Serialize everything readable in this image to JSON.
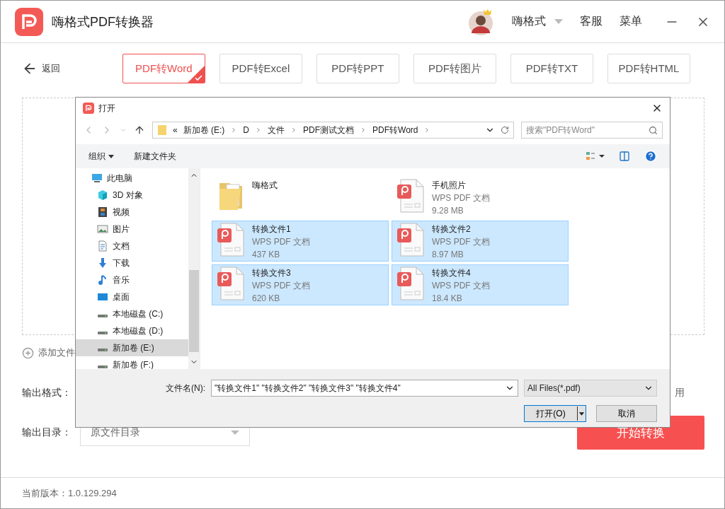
{
  "app": {
    "title": "嗨格式PDF转换器",
    "user": "嗨格式",
    "links": [
      "客服",
      "菜单"
    ],
    "back": "返回",
    "formats": [
      {
        "label": "PDF转Word",
        "selected": true
      },
      {
        "label": "PDF转Excel",
        "selected": false
      },
      {
        "label": "PDF转PPT",
        "selected": false
      },
      {
        "label": "PDF转图片",
        "selected": false
      },
      {
        "label": "PDF转TXT",
        "selected": false
      },
      {
        "label": "PDF转HTML",
        "selected": false
      }
    ],
    "add_file": "添加文件",
    "output_format_label": "输出格式：",
    "partial_text": "用",
    "output_dir": {
      "label": "输出目录：",
      "value": "原文件目录"
    },
    "start_button": "开始转换",
    "version": "当前版本：1.0.129.294"
  },
  "dialog": {
    "title": "打开",
    "path": [
      "«",
      "新加卷 (E:)",
      "D",
      "文件",
      "PDF测试文档",
      "PDF转Word"
    ],
    "search": {
      "placeholder": "搜索\"PDF转Word\""
    },
    "toolbar": [
      "组织",
      "新建文件夹"
    ],
    "nav": [
      {
        "label": "此电脑",
        "kind": "pc",
        "selected": false
      },
      {
        "label": "3D 对象",
        "kind": "cube",
        "selected": false
      },
      {
        "label": "视频",
        "kind": "video",
        "selected": false
      },
      {
        "label": "图片",
        "kind": "image",
        "selected": false
      },
      {
        "label": "文档",
        "kind": "doc",
        "selected": false
      },
      {
        "label": "下载",
        "kind": "download",
        "selected": false
      },
      {
        "label": "音乐",
        "kind": "music",
        "selected": false
      },
      {
        "label": "桌面",
        "kind": "desktop",
        "selected": false
      },
      {
        "label": "本地磁盘 (C:)",
        "kind": "drive",
        "selected": false
      },
      {
        "label": "本地磁盘 (D:)",
        "kind": "drive",
        "selected": false
      },
      {
        "label": "新加卷 (E:)",
        "kind": "drive",
        "selected": true
      },
      {
        "label": "新加卷 (F:)",
        "kind": "drive",
        "selected": false
      }
    ],
    "files": [
      {
        "name": "嗨格式",
        "kind": "folder",
        "selected": false
      },
      {
        "name": "手机照片",
        "type": "WPS PDF 文档",
        "size": "9.28 MB",
        "kind": "pdf",
        "selected": false
      },
      {
        "name": "转换文件1",
        "type": "WPS PDF 文档",
        "size": "437 KB",
        "kind": "pdf",
        "selected": true
      },
      {
        "name": "转换文件2",
        "type": "WPS PDF 文档",
        "size": "8.97 MB",
        "kind": "pdf",
        "selected": true
      },
      {
        "name": "转换文件3",
        "type": "WPS PDF 文档",
        "size": "620 KB",
        "kind": "pdf",
        "selected": true
      },
      {
        "name": "转换文件4",
        "type": "WPS PDF 文档",
        "size": "18.4 KB",
        "kind": "pdf",
        "selected": true
      }
    ],
    "filename_label": "文件名(N):",
    "filename": "\"转换文件1\" \"转换文件2\" \"转换文件3\" \"转换文件4\"",
    "filter": "All Files(*.pdf)",
    "open_button": "打开(O)",
    "cancel_button": "取消"
  }
}
